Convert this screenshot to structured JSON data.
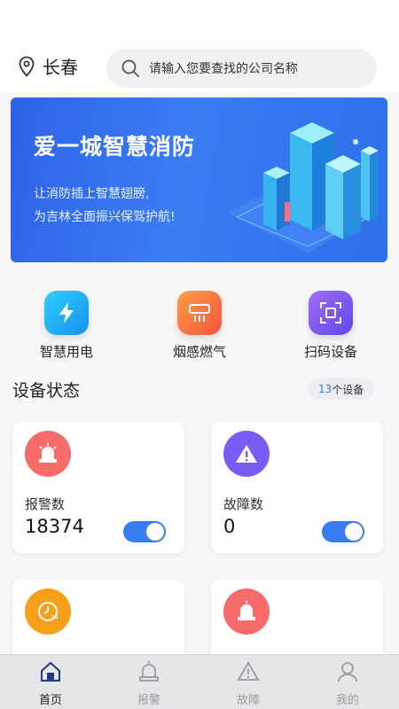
{
  "header": {
    "city": "长春",
    "search_placeholder": "请输入您要查找的公司名称"
  },
  "banner": {
    "title": "爱一城智慧消防",
    "subtitle_line1": "让消防插上智慧翅膀,",
    "subtitle_line2": "为吉林全面振兴保驾护航!"
  },
  "quick_actions": [
    {
      "label": "智慧用电",
      "icon": "lightning-icon",
      "color": "#1aa7f0"
    },
    {
      "label": "烟感燃气",
      "icon": "smoke-detector-icon",
      "color": "#f86a3a"
    },
    {
      "label": "扫码设备",
      "icon": "scan-icon",
      "color": "#7a5cf5"
    }
  ],
  "device_status": {
    "title": "设备状态",
    "count": "13",
    "count_suffix": "个设备"
  },
  "cards": [
    {
      "label": "报警数",
      "value": "18374",
      "icon": "alarm-light-icon",
      "color": "#f76b6b",
      "toggle_on": true
    },
    {
      "label": "故障数",
      "value": "0",
      "icon": "warning-triangle-icon",
      "color": "#7a5cf5",
      "toggle_on": true
    },
    {
      "label": "",
      "value": "",
      "icon": "24h-clock-icon",
      "color": "#f6a019"
    },
    {
      "label": "",
      "value": "",
      "icon": "alarm-light-icon",
      "color": "#f76b6b"
    }
  ],
  "tabs": [
    {
      "label": "首页",
      "icon": "home-icon",
      "active": true
    },
    {
      "label": "报警",
      "icon": "alarm-light-icon",
      "active": false
    },
    {
      "label": "故障",
      "icon": "warning-triangle-icon",
      "active": false
    },
    {
      "label": "我的",
      "icon": "user-icon",
      "active": false
    }
  ]
}
